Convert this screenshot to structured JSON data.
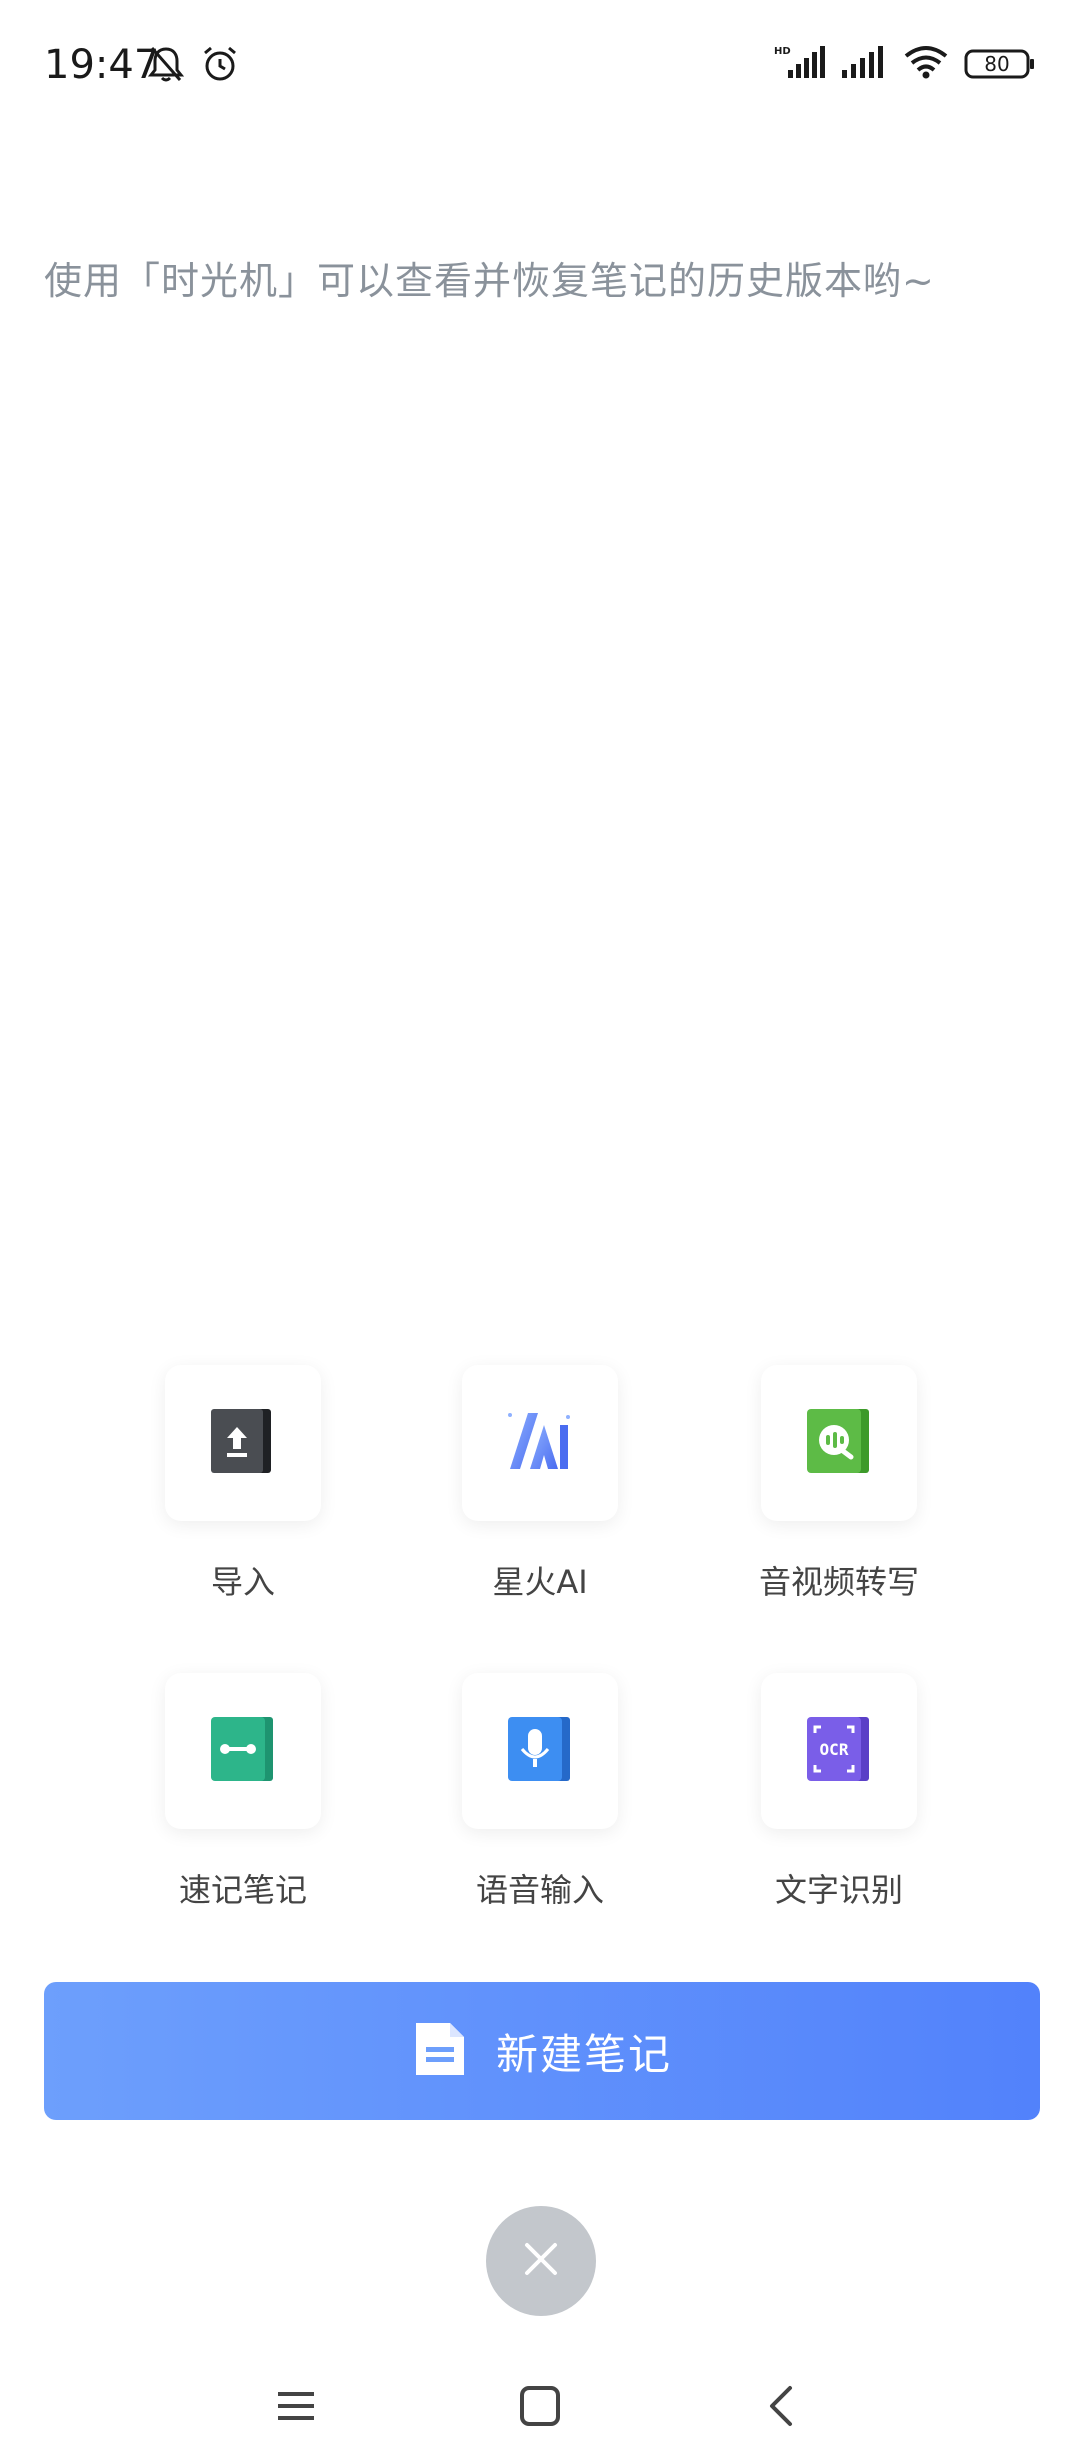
{
  "status_bar": {
    "time": "19:47",
    "icons": [
      "bell-muted-icon",
      "alarm-icon",
      "hd-signal-icon",
      "signal-icon",
      "wifi-icon",
      "battery-icon"
    ],
    "battery": "80"
  },
  "editor": {
    "hint": "使用「时光机」可以查看并恢复笔记的历史版本哟~"
  },
  "tools": [
    {
      "label": "导入",
      "icon": "import-icon",
      "color": "#3a3d42"
    },
    {
      "label": "星火AI",
      "icon": "spark-ai-icon",
      "color": "#6a8bf7"
    },
    {
      "label": "音视频转写",
      "icon": "av-transcribe-icon",
      "color": "#5dbb46"
    },
    {
      "label": "速记笔记",
      "icon": "quick-note-icon",
      "color": "#2db58a"
    },
    {
      "label": "语音输入",
      "icon": "microphone-icon",
      "color": "#3d8ef2"
    },
    {
      "label": "文字识别",
      "icon": "ocr-icon",
      "color": "#7a5ee8"
    }
  ],
  "new_note": {
    "label": "新建笔记",
    "gradient_start": "#6d9ffc",
    "gradient_end": "#5282fb"
  },
  "close_button": {
    "icon": "close-icon",
    "color": "#c3c7cc"
  },
  "nav": {
    "icons": [
      "menu-icon",
      "home-icon",
      "back-icon"
    ]
  }
}
